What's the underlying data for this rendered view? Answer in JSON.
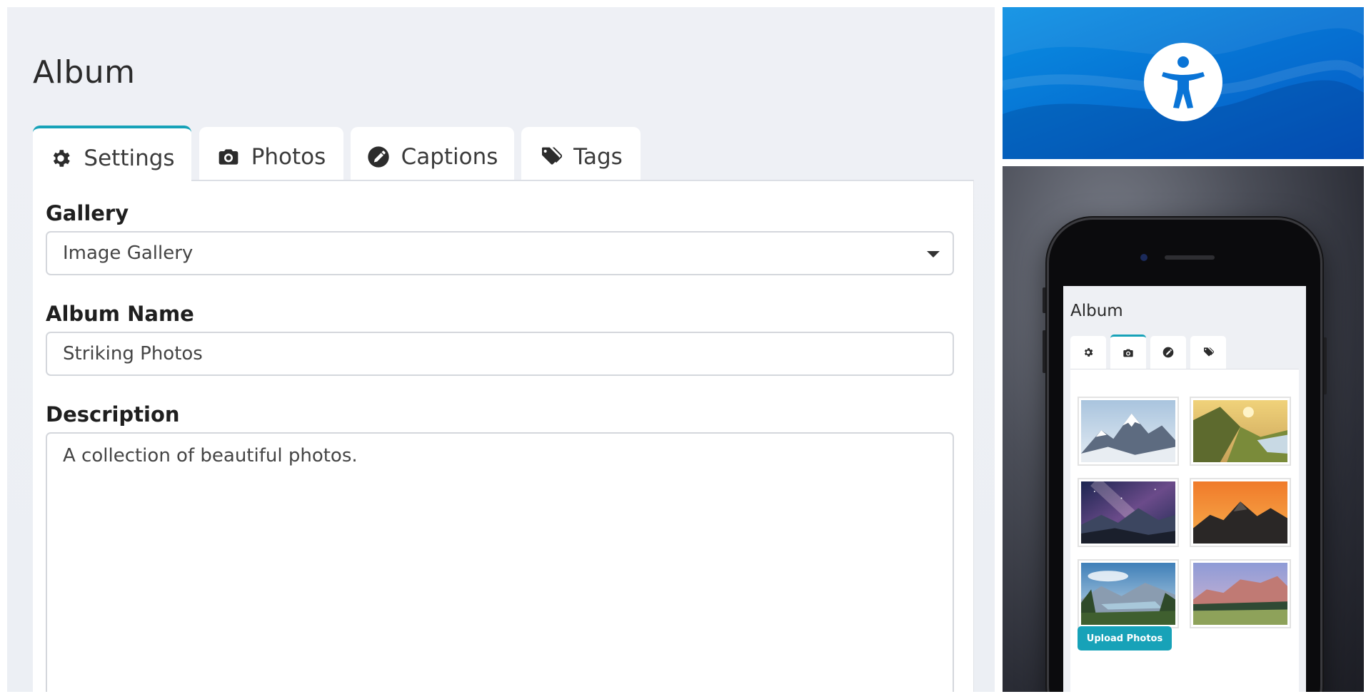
{
  "page": {
    "title": "Album"
  },
  "tabs": [
    {
      "label": "Settings",
      "icon": "gear-icon",
      "active": true
    },
    {
      "label": "Photos",
      "icon": "camera-icon",
      "active": false
    },
    {
      "label": "Captions",
      "icon": "pencil-icon",
      "active": false
    },
    {
      "label": "Tags",
      "icon": "tags-icon",
      "active": false
    }
  ],
  "form": {
    "gallery_label": "Gallery",
    "gallery_value": "Image Gallery",
    "name_label": "Album Name",
    "name_value": "Striking Photos",
    "description_label": "Description",
    "description_value": "A collection of beautiful photos."
  },
  "banner": {
    "icon": "accessibility-icon"
  },
  "phone": {
    "title": "Album",
    "tab_icons": [
      "gear-icon",
      "camera-icon",
      "pencil-icon",
      "tags-icon"
    ],
    "active_tab": "camera-icon",
    "thumbnails": [
      "snowy-mountain",
      "sunset-valley",
      "milky-way-mountains",
      "orange-sky-ridge",
      "lake-valley",
      "pink-peaks-meadow"
    ],
    "upload_label": "Upload Photos"
  },
  "colors": {
    "accent": "#17a2b8",
    "banner_blue": "#0674d4",
    "panel_bg": "#eceff4"
  }
}
